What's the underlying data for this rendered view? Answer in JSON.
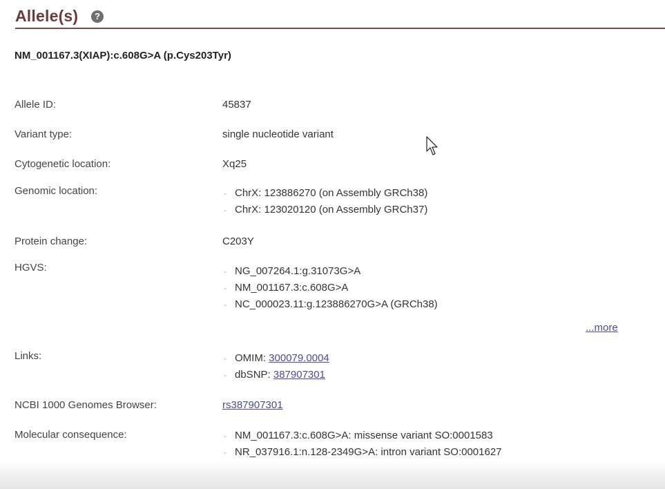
{
  "section": {
    "title": "Allele(s)",
    "help_icon": "?"
  },
  "allele_name": "NM_001167.3(XIAP):c.608G>A (p.Cys203Tyr)",
  "rows": {
    "allele_id": {
      "label": "Allele ID:",
      "value": "45837"
    },
    "variant_type": {
      "label": "Variant type:",
      "value": "single nucleotide variant"
    },
    "cytogenetic": {
      "label": "Cytogenetic location:",
      "value": "Xq25"
    },
    "genomic": {
      "label": "Genomic location:",
      "items": [
        "ChrX: 123886270 (on Assembly GRCh38)",
        "ChrX: 123020120 (on Assembly GRCh37)"
      ]
    },
    "protein_change": {
      "label": "Protein change:",
      "value": "C203Y"
    },
    "hgvs": {
      "label": "HGVS:",
      "items": [
        "NG_007264.1:g.31073G>A",
        "NM_001167.3:c.608G>A",
        "NC_000023.11:g.123886270G>A (GRCh38)"
      ],
      "more_label": "...more"
    },
    "links": {
      "label": "Links:",
      "items": [
        {
          "prefix": "OMIM: ",
          "link": "300079.0004"
        },
        {
          "prefix": "dbSNP: ",
          "link": "387907301"
        }
      ]
    },
    "genomes_browser": {
      "label": "NCBI 1000 Genomes Browser:",
      "link": "rs387907301"
    },
    "molecular": {
      "label": "Molecular consequence:",
      "items": [
        "NM_001167.3:c.608G>A: missense variant SO:0001583",
        "NR_037916.1:n.128-2349G>A: intron variant SO:0001627"
      ]
    }
  },
  "icons": {
    "help": "help-icon",
    "cursor": "mouse-pointer-icon"
  }
}
